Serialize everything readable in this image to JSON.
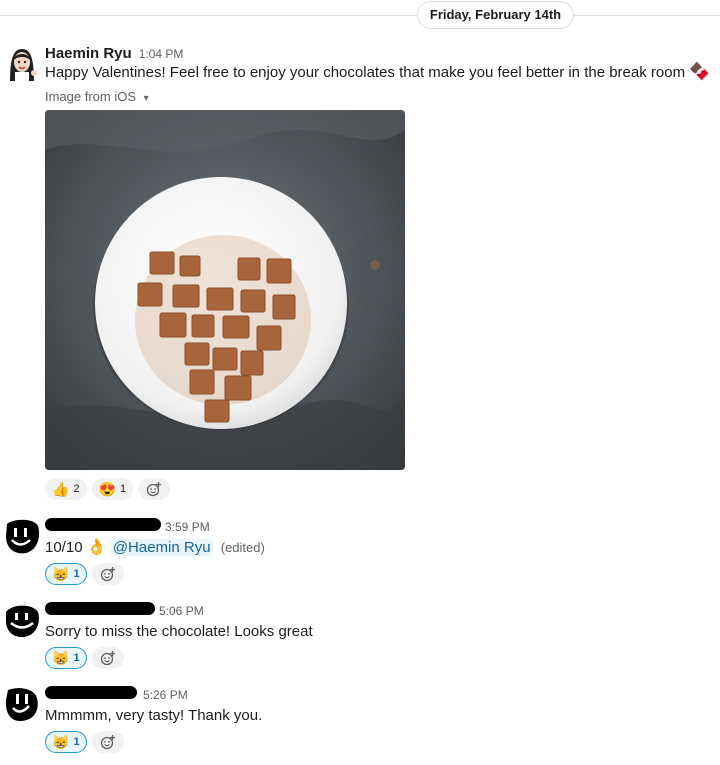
{
  "date_divider": "Friday, February 14th",
  "messages": [
    {
      "author": "Haemin Ryu",
      "time": "1:04 PM",
      "text": "Happy Valentines! Feel free to enjoy your chocolates that make you feel better in the break room",
      "trailing_emoji": "🍫",
      "attachment_label": "Image from iOS",
      "attachment_toggle": "▾",
      "reactions": [
        {
          "emoji": "👍",
          "count": "2"
        },
        {
          "emoji": "😍",
          "count": "1"
        }
      ]
    },
    {
      "author": "",
      "time": "3:59 PM",
      "text": "10/10",
      "emoji": "👌",
      "mention": "@Haemin Ryu",
      "edited": "(edited)",
      "reactions": [
        {
          "emoji": "😸",
          "count": "1"
        }
      ]
    },
    {
      "author": "",
      "time": "5:06 PM",
      "text": "Sorry to miss the chocolate! Looks great",
      "reactions": [
        {
          "emoji": "😸",
          "count": "1"
        }
      ]
    },
    {
      "author": "",
      "time": "5:26 PM",
      "text": "Mmmmm, very tasty! Thank you.",
      "reactions": [
        {
          "emoji": "😸",
          "count": "1"
        }
      ]
    }
  ],
  "icons": {
    "add_reaction": "add-reaction-icon",
    "attachment_toggle": "caret-down-icon"
  },
  "colors": {
    "link": "#1264a3",
    "reaction_active_border": "#1d9bd1",
    "redaction": "#000000"
  }
}
